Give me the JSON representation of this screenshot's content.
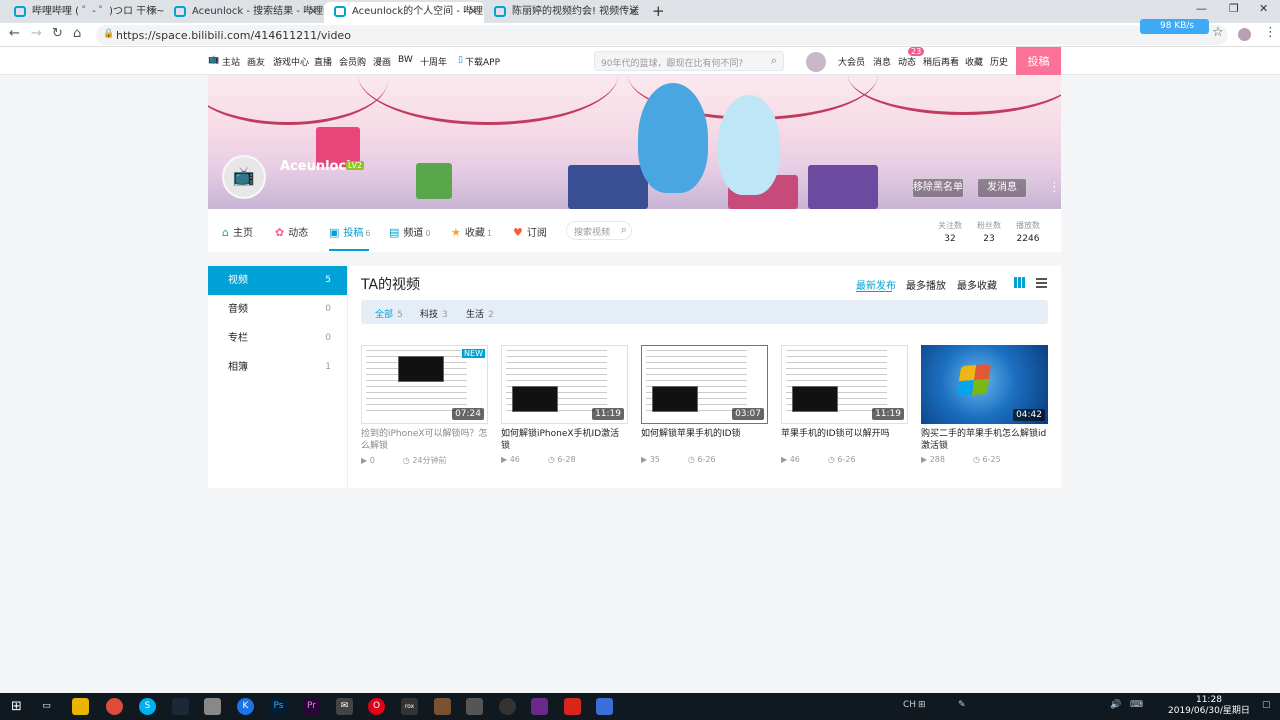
{
  "browser": {
    "tabs": [
      {
        "title": "哔哩哔哩 ( ゜- ゜)つロ 干杯~-bili"
      },
      {
        "title": "Aceunlock - 搜索结果 - 哔哩哔哩"
      },
      {
        "title": "Aceunlock的个人空间 - 哔哩哔哩"
      },
      {
        "title": "陈丽婷的视频约会! 视频传送"
      }
    ],
    "url": "https://space.bilibili.com/414611211/video",
    "speed": "98 KB/s"
  },
  "topnav": {
    "items": [
      "主站",
      "画友",
      "游戏中心",
      "直播",
      "会员购",
      "漫画",
      "BW",
      "十周年",
      "下载APP"
    ],
    "search_placeholder": "90年代的篮球，跟现在比有何不同?",
    "right_items": [
      "大会员",
      "消息",
      "动态",
      "稍后再看",
      "收藏",
      "历史"
    ],
    "dynamic_badge": "23",
    "upload": "投稿"
  },
  "profile": {
    "name": "Aceunlock",
    "level": "LV2",
    "remove_blacklist": "移除黑名单",
    "message": "发消息"
  },
  "space_nav": {
    "tabs": [
      {
        "label": "主页",
        "count": ""
      },
      {
        "label": "动态",
        "count": ""
      },
      {
        "label": "投稿",
        "count": "6"
      },
      {
        "label": "频道",
        "count": "0"
      },
      {
        "label": "收藏",
        "count": "1"
      },
      {
        "label": "订阅",
        "count": ""
      }
    ],
    "search_placeholder": "搜索视频",
    "stats": [
      {
        "label": "关注数",
        "value": "32"
      },
      {
        "label": "粉丝数",
        "value": "23"
      },
      {
        "label": "播放数",
        "value": "2246"
      }
    ]
  },
  "sidebar": [
    {
      "label": "视频",
      "count": "5"
    },
    {
      "label": "音频",
      "count": "0"
    },
    {
      "label": "专栏",
      "count": "0"
    },
    {
      "label": "相簿",
      "count": "1"
    }
  ],
  "videos_section": {
    "title": "TA的视频",
    "sort": [
      "最新发布",
      "最多播放",
      "最多收藏"
    ],
    "filters": [
      {
        "label": "全部",
        "count": "5"
      },
      {
        "label": "科技",
        "count": "3"
      },
      {
        "label": "生活",
        "count": "2"
      }
    ]
  },
  "videos": [
    {
      "title": "捡到的iPhoneX可以解锁吗？怎么解锁",
      "duration": "07:24",
      "plays": "0",
      "date": "24分钟前",
      "new": "NEW"
    },
    {
      "title": "如何解锁iPhoneX手机ID激活锁",
      "duration": "11:19",
      "plays": "46",
      "date": "6-28"
    },
    {
      "title": "如何解锁苹果手机的ID锁",
      "duration": "03:07",
      "plays": "35",
      "date": "6-26"
    },
    {
      "title": "苹果手机的ID锁可以解开吗",
      "duration": "11:19",
      "plays": "46",
      "date": "6-26"
    },
    {
      "title": "购买二手的苹果手机怎么解锁id激活锁",
      "duration": "04:42",
      "plays": "288",
      "date": "6-25"
    }
  ],
  "taskbar": {
    "time": "11:28",
    "date": "2019/06/30/星期日",
    "ime": "CH"
  }
}
